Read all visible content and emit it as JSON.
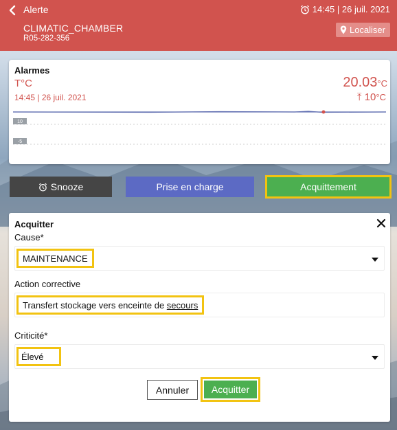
{
  "header": {
    "title": "Alerte",
    "time": "14:45 | 26 juil. 2021",
    "device_name": "CLIMATIC_CHAMBER",
    "device_id": "R05-282-356",
    "localiser_label": "Localiser"
  },
  "alarm_card": {
    "title": "Alarmes",
    "sensor_label": "T°C",
    "timestamp": "14:45 | 26 juil. 2021",
    "value": "20.03",
    "value_unit": "°C",
    "threshold": "10",
    "threshold_unit": "°C",
    "threshold_symbol": "⤒",
    "y_tick_labels": [
      "10",
      "-5"
    ]
  },
  "actions": {
    "snooze_label": "Snooze",
    "prise_label": "Prise en charge",
    "acquittement_label": "Acquittement"
  },
  "acquitter_form": {
    "title": "Acquitter",
    "cause_label": "Cause*",
    "cause_value": "MAINTENANCE",
    "action_label": "Action corrective",
    "action_value_prefix": "Transfert stockage vers enceinte de ",
    "action_value_link": "secours",
    "criticite_label": "Criticité*",
    "criticite_value": "Élevé",
    "annuler_label": "Annuler",
    "acquitter_label": "Acquitter"
  },
  "colors": {
    "header_bg": "#d1534e",
    "alert_text": "#d1534e",
    "snooze_bg": "#454545",
    "prise_bg": "#5c6ac4",
    "acquit_bg": "#4caf50",
    "highlight": "#f2c311"
  }
}
